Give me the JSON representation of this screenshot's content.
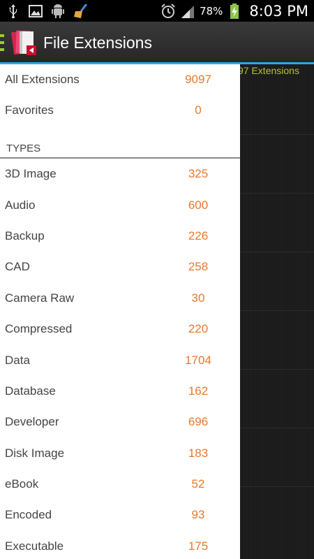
{
  "status_bar": {
    "icons_left": [
      "usb-icon",
      "image-icon",
      "android-icon",
      "broom-icon"
    ],
    "icons_right": [
      "alarm-icon",
      "signal-icon"
    ],
    "battery_percent": "78%",
    "time": "8:03 PM"
  },
  "app_bar": {
    "title": "File Extensions"
  },
  "background": {
    "extension_count_text": "97 Extensions"
  },
  "drawer": {
    "top_items": [
      {
        "label": "All Extensions",
        "count": "9097"
      },
      {
        "label": "Favorites",
        "count": "0"
      }
    ],
    "types_header": "TYPES",
    "types": [
      {
        "label": "3D Image",
        "count": "325"
      },
      {
        "label": "Audio",
        "count": "600"
      },
      {
        "label": "Backup",
        "count": "226"
      },
      {
        "label": "CAD",
        "count": "258"
      },
      {
        "label": "Camera Raw",
        "count": "30"
      },
      {
        "label": "Compressed",
        "count": "220"
      },
      {
        "label": "Data",
        "count": "1704"
      },
      {
        "label": "Database",
        "count": "162"
      },
      {
        "label": "Developer",
        "count": "696"
      },
      {
        "label": "Disk Image",
        "count": "183"
      },
      {
        "label": "eBook",
        "count": "52"
      },
      {
        "label": "Encoded",
        "count": "93"
      },
      {
        "label": "Executable",
        "count": "175"
      }
    ]
  },
  "colors": {
    "count_color": "#e8792a",
    "accent_blue": "#2ea7e0",
    "drawer_indicator": "#9acd32"
  }
}
